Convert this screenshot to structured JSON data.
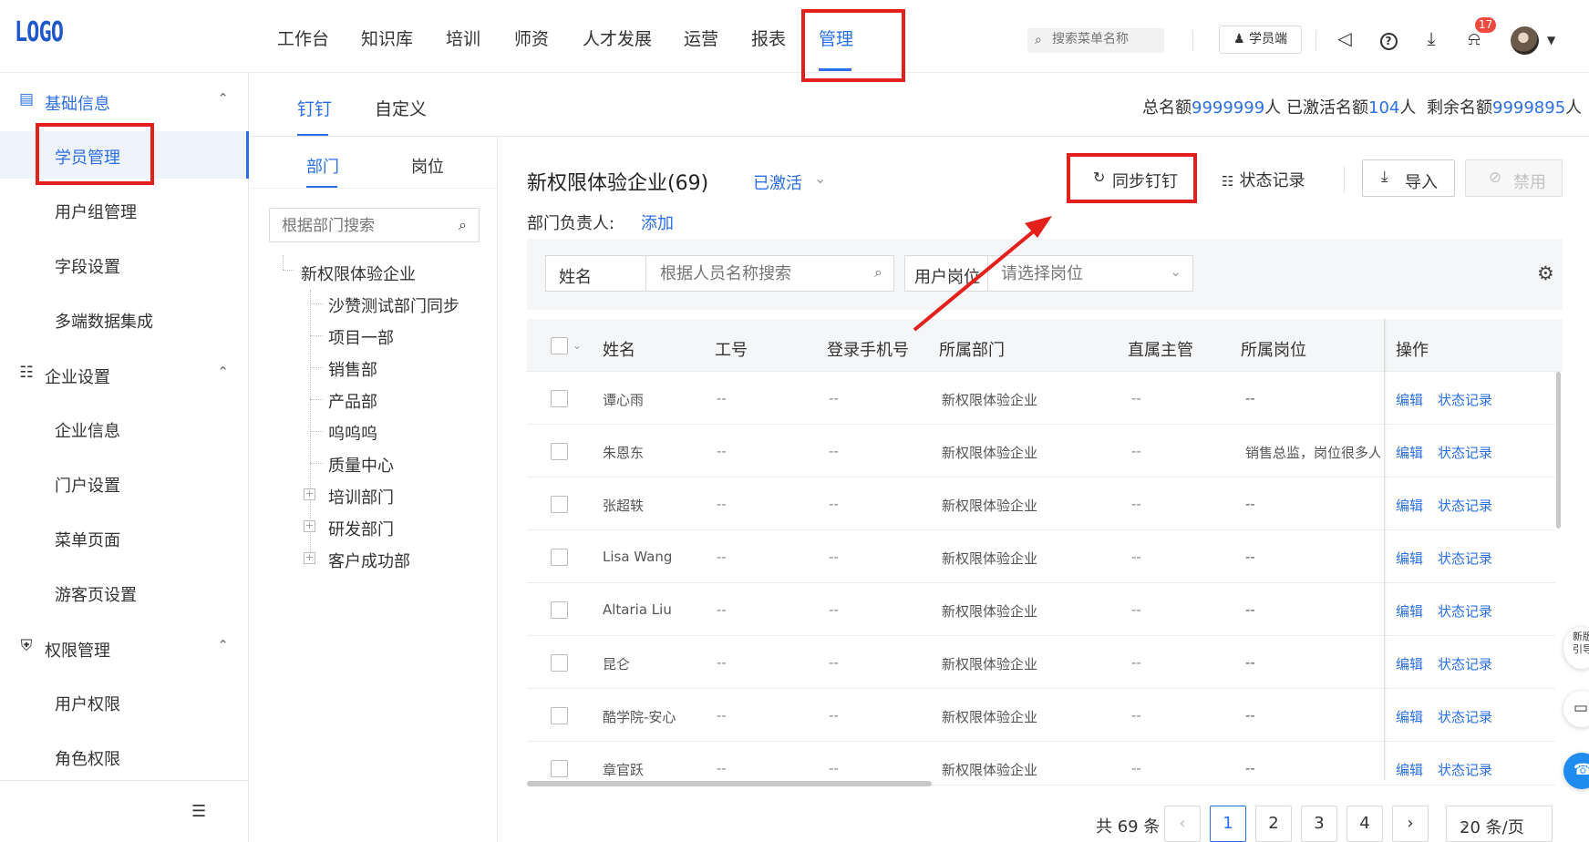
{
  "topbar": {
    "logo": "LOGO",
    "nav": [
      "工作台",
      "知识库",
      "培训",
      "师资",
      "人才发展",
      "运营",
      "报表",
      "管理"
    ],
    "active_nav": "管理",
    "search_placeholder": "搜索菜单名称",
    "student_btn": "学员端",
    "notif_count": "17",
    "icons": [
      "speaker-icon",
      "help-icon",
      "download-icon",
      "bell-icon"
    ]
  },
  "sidebar": {
    "groups": [
      {
        "label": "基础信息",
        "icon": "book-icon",
        "items": [
          "学员管理",
          "用户组管理",
          "字段设置",
          "多端数据集成"
        ]
      },
      {
        "label": "企业设置",
        "icon": "building-icon",
        "items": [
          "企业信息",
          "门户设置",
          "菜单页面",
          "游客页设置"
        ]
      },
      {
        "label": "权限管理",
        "icon": "shield-icon",
        "items": [
          "用户权限",
          "角色权限"
        ]
      }
    ],
    "active_item": "学员管理"
  },
  "tabs": {
    "items": [
      "钉钉",
      "自定义"
    ],
    "active": "钉钉"
  },
  "quota": {
    "total_label": "总名额",
    "total": "9999999",
    "total_unit": "人",
    "activated_label": "已激活名额",
    "activated": "104",
    "activated_unit": "人",
    "remaining_label": "剩余名额",
    "remaining": "9999895",
    "remaining_unit": "人"
  },
  "left_panel": {
    "tabs": [
      "部门",
      "岗位"
    ],
    "active_tab": "部门",
    "search_placeholder": "根据部门搜索",
    "tree": {
      "root": "新权限体验企业",
      "children": [
        "沙赞测试部门同步",
        "项目一部",
        "销售部",
        "产品部",
        "呜呜呜",
        "质量中心"
      ],
      "expandable": [
        "培训部门",
        "研发部门",
        "客户成功部"
      ]
    }
  },
  "main": {
    "title": "新权限体验企业(69)",
    "status": "已激活",
    "dept_head_label": "部门负责人:",
    "dept_head_add": "添加",
    "buttons": {
      "sync": "同步钉钉",
      "log": "状态记录",
      "import": "导入",
      "disable": "禁用"
    },
    "filter": {
      "field": "姓名",
      "name_placeholder": "根据人员名称搜索",
      "post_label": "用户岗位",
      "post_placeholder": "请选择岗位"
    }
  },
  "table": {
    "columns": [
      "姓名",
      "工号",
      "登录手机号",
      "所属部门",
      "直属主管",
      "所属岗位",
      "操作"
    ],
    "rows": [
      {
        "name": "谭心雨",
        "id": "--",
        "phone": "--",
        "dept": "新权限体验企业",
        "mgr": "--",
        "post": "--"
      },
      {
        "name": "朱恩东",
        "id": "--",
        "phone": "--",
        "dept": "新权限体验企业",
        "mgr": "--",
        "post": "销售总监，岗位很多人"
      },
      {
        "name": "张超轶",
        "id": "--",
        "phone": "--",
        "dept": "新权限体验企业",
        "mgr": "--",
        "post": "--"
      },
      {
        "name": "Lisa Wang",
        "id": "--",
        "phone": "--",
        "dept": "新权限体验企业",
        "mgr": "--",
        "post": "--"
      },
      {
        "name": "Altaria Liu",
        "id": "--",
        "phone": "--",
        "dept": "新权限体验企业",
        "mgr": "--",
        "post": "--"
      },
      {
        "name": "昆仑",
        "id": "--",
        "phone": "--",
        "dept": "新权限体验企业",
        "mgr": "--",
        "post": "--"
      },
      {
        "name": "酷学院-安心",
        "id": "--",
        "phone": "--",
        "dept": "新权限体验企业",
        "mgr": "--",
        "post": "--"
      },
      {
        "name": "章官跃",
        "id": "--",
        "phone": "--",
        "dept": "新权限体验企业",
        "mgr": "--",
        "post": "--"
      }
    ],
    "action_edit": "编辑",
    "action_log": "状态记录"
  },
  "pagination": {
    "total_text": "共 69 条",
    "pages": [
      "1",
      "2",
      "3",
      "4"
    ],
    "current": "1",
    "page_size": "20 条/页"
  },
  "floating": {
    "text": "新版\n引导"
  },
  "colors": {
    "accent": "#2b6fe6",
    "annotation": "#e3201b"
  }
}
